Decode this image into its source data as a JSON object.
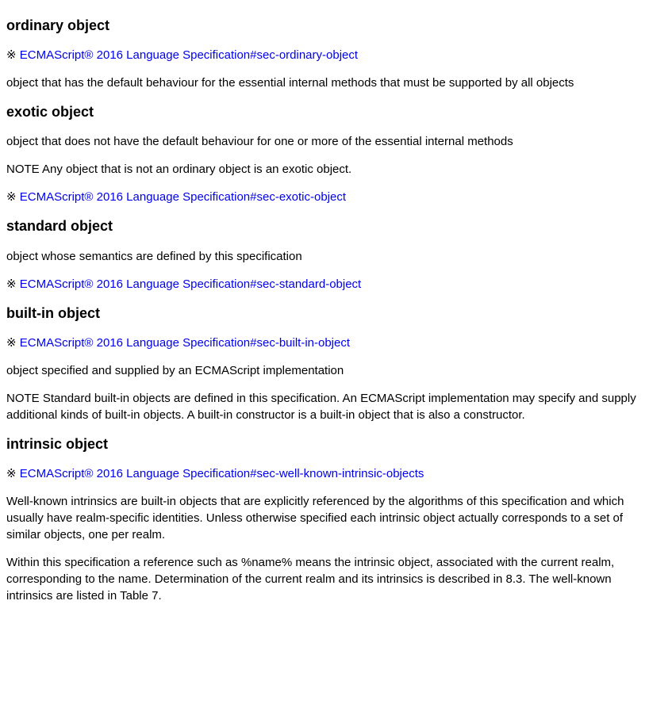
{
  "sections": {
    "ordinary": {
      "heading": "ordinary object",
      "ref_symbol": "※ ",
      "ref_link": "ECMAScript® 2016 Language Specification#sec-ordinary-object",
      "definition": "object that has the default behaviour for the essential internal methods that must be supported by all objects"
    },
    "exotic": {
      "heading": "exotic object",
      "definition": "object that does not have the default behaviour for one or more of the essential internal methods",
      "note": "NOTE Any object that is not an ordinary object is an exotic object.",
      "ref_symbol": "※ ",
      "ref_link": "ECMAScript® 2016 Language Specification#sec-exotic-object"
    },
    "standard": {
      "heading": "standard object",
      "definition": "object whose semantics are defined by this specification",
      "ref_symbol": "※ ",
      "ref_link": "ECMAScript® 2016 Language Specification#sec-standard-object"
    },
    "builtin": {
      "heading": "built-in object",
      "ref_symbol": "※ ",
      "ref_link": "ECMAScript® 2016 Language Specification#sec-built-in-object",
      "definition": "object specified and supplied by an ECMAScript implementation",
      "note": "NOTE Standard built-in objects are defined in this specification. An ECMAScript implementation may specify and supply additional kinds of built-in objects. A built-in constructor is a built-in object that is also a constructor."
    },
    "intrinsic": {
      "heading": "intrinsic object",
      "ref_symbol": "※ ",
      "ref_link": "ECMAScript® 2016 Language Specification#sec-well-known-intrinsic-objects",
      "para1": "Well-known intrinsics are built-in objects that are explicitly referenced by the algorithms of this specification and which usually have realm-specific identities. Unless otherwise specified each intrinsic object actually corresponds to a set of similar objects, one per realm.",
      "para2": "Within this specification a reference such as %name% means the intrinsic object, associated with the current realm, corresponding to the name. Determination of the current realm and its intrinsics is described in 8.3. The well-known intrinsics are listed in Table 7."
    }
  }
}
